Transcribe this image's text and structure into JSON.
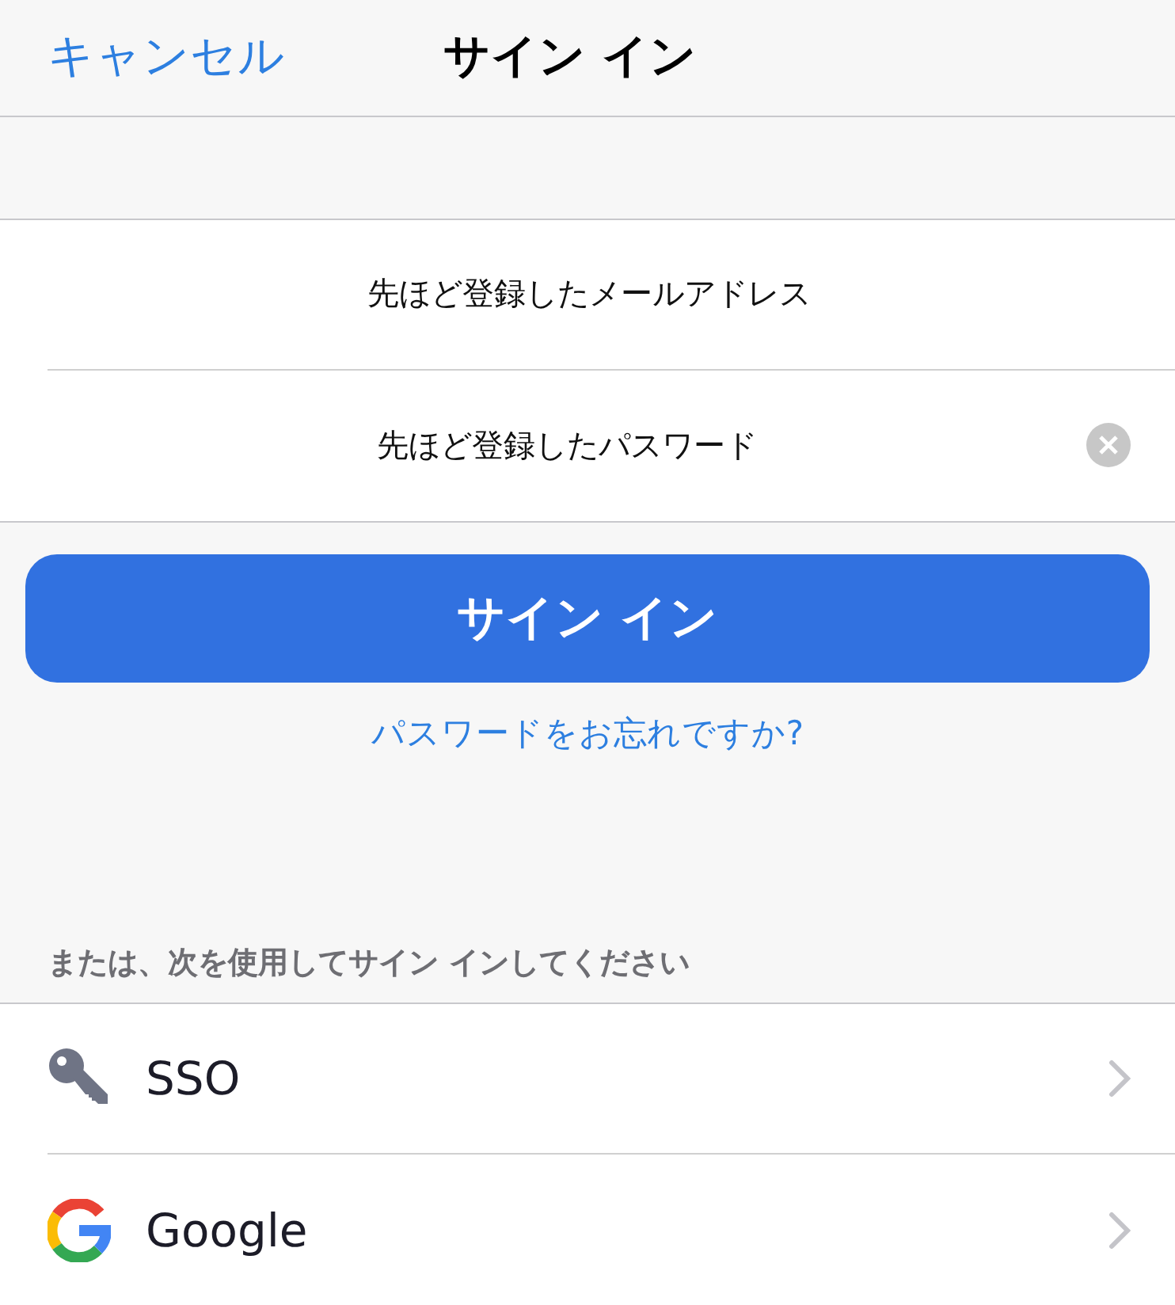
{
  "nav": {
    "cancel": "キャンセル",
    "title": "サイン イン"
  },
  "fields": [
    {
      "value": "先ほど登録したメールアドレス",
      "clear_button": false
    },
    {
      "value": "先ほど登録したパスワード",
      "clear_button": true
    }
  ],
  "sign_in_button": "サイン イン",
  "forgot_link": "パスワードをお忘れですか?",
  "alt_section": {
    "label": "または、次を使用してサイン インしてください",
    "providers": [
      {
        "kind": "sso",
        "label": "SSO"
      },
      {
        "kind": "google",
        "label": "Google"
      }
    ]
  }
}
